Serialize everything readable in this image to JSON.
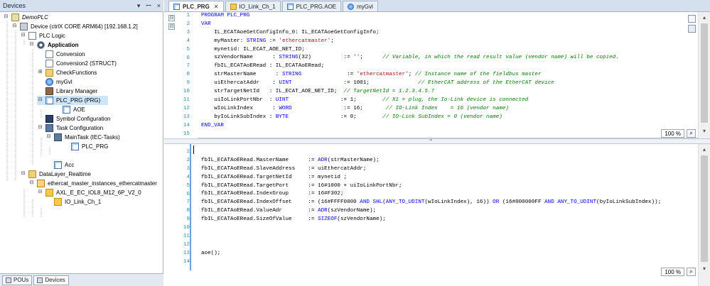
{
  "devices_panel": {
    "title": "Devices",
    "controls": [
      "▾",
      "ꟷ",
      "×"
    ],
    "tree": [
      {
        "label": "DemoPLC",
        "italic": true
      },
      {
        "label": "Device (ctrlX CORE ARM64) [192.168.1.2]"
      },
      {
        "label": "PLC Logic"
      },
      {
        "label": "Application",
        "bold": true
      },
      {
        "label": "Conversion"
      },
      {
        "label": "Conversion2 (STRUCT)"
      },
      {
        "label": "CheckFunctions"
      },
      {
        "label": "myGvl"
      },
      {
        "label": "Library Manager"
      },
      {
        "label": "PLC_PRG (PRG)"
      },
      {
        "label": "AOE"
      },
      {
        "label": "Symbol Configuration"
      },
      {
        "label": "Task Configuration"
      },
      {
        "label": "MainTask (IEC-Tasks)"
      },
      {
        "label": "PLC_PRG"
      },
      {
        "label": "Acc"
      },
      {
        "label": "DataLayer_Realtime"
      },
      {
        "label": "ethercat_master_instances_ethercatmaster"
      },
      {
        "label": "AXL_E_EC_IOL8_M12_6P_V2_0"
      },
      {
        "label": "IO_Link_Ch_1"
      }
    ],
    "bottom_tabs": [
      "POUs",
      "Devices"
    ]
  },
  "editor": {
    "tabs": [
      {
        "label": "PLC_PRG",
        "active": true
      },
      {
        "label": "IO_Link_Ch_1"
      },
      {
        "label": "PLC_PRG.AOE"
      },
      {
        "label": "myGvl"
      }
    ],
    "decl_zoom": "100 %",
    "impl_zoom": "100 %",
    "decl_line_numbers": [
      "1",
      "2",
      "3",
      "4",
      "5",
      "6",
      "7",
      "8",
      "9",
      "10",
      "11",
      "12",
      "13",
      "14",
      "15"
    ],
    "impl_line_numbers": [
      "1",
      "2",
      "3",
      "4",
      "5",
      "6",
      "7",
      "8",
      "9",
      "10",
      "11",
      "12",
      "13",
      "14"
    ],
    "declaration_lines": [
      [
        {
          "t": "PROGRAM PLC_PRG",
          "c": "kw"
        }
      ],
      [
        {
          "t": "VAR",
          "c": "kw"
        }
      ],
      [
        {
          "t": "    IL_ECATAoeGetConfigInfo_0: IL_ECATAoeGetConfigInfo;",
          "c": ""
        }
      ],
      [
        {
          "t": "    myMaster: ",
          "c": ""
        },
        {
          "t": "STRING",
          "c": "kw"
        },
        {
          "t": " := ",
          "c": ""
        },
        {
          "t": "'ethercatmaster'",
          "c": "str"
        },
        {
          "t": ";",
          "c": ""
        }
      ],
      [
        {
          "t": "    mynetid: IL_ECAT_AOE_NET_ID;",
          "c": ""
        }
      ],
      [
        {
          "t": "    szVendorName      : ",
          "c": ""
        },
        {
          "t": "STRING",
          "c": "kw"
        },
        {
          "t": "(32)          := ",
          "c": ""
        },
        {
          "t": "''",
          "c": "str"
        },
        {
          "t": ";      ",
          "c": ""
        },
        {
          "t": "// Variable, in which the read result value (vendor name) will be copied.",
          "c": "cm"
        }
      ],
      [
        {
          "t": "    fbIL_ECATAoERead : IL_ECATAoERead;",
          "c": ""
        }
      ],
      [
        {
          "t": "    strMasterName      : ",
          "c": ""
        },
        {
          "t": "STRING",
          "c": "kw"
        },
        {
          "t": "              := ",
          "c": ""
        },
        {
          "t": "'ethercatmaster'",
          "c": "str"
        },
        {
          "t": "; ",
          "c": ""
        },
        {
          "t": "// Instance name of the fieldbus master",
          "c": "cm"
        }
      ],
      [
        {
          "t": "    uiEthercatAddr    : ",
          "c": ""
        },
        {
          "t": "UINT",
          "c": "kw"
        },
        {
          "t": "                := 1001;               ",
          "c": ""
        },
        {
          "t": "// EtherCAT address of the EtherCAT device",
          "c": "cm"
        }
      ],
      [
        {
          "t": "    strTargetNetId   : IL_ECAT_AOE_NET_ID;  ",
          "c": ""
        },
        {
          "t": "// TargetNetId = 1.2.3.4.5.7",
          "c": "cm"
        }
      ],
      [
        {
          "t": "    uiIoLinkPortNbr  : ",
          "c": ""
        },
        {
          "t": "UINT",
          "c": "kw"
        },
        {
          "t": "                := 1;        ",
          "c": ""
        },
        {
          "t": "// X1 = plug, the Io-Link device is connected",
          "c": "cm"
        }
      ],
      [
        {
          "t": "    wIoLinkIndex      : ",
          "c": ""
        },
        {
          "t": "WORD",
          "c": "kw"
        },
        {
          "t": "                := 16;       ",
          "c": ""
        },
        {
          "t": "// IO-Link Index    = 16 (vendor name)",
          "c": "cm"
        }
      ],
      [
        {
          "t": "    byIoLinkSubIndex : ",
          "c": ""
        },
        {
          "t": "BYTE",
          "c": "kw"
        },
        {
          "t": "                := 0;        ",
          "c": ""
        },
        {
          "t": "// IO-Link SubIndex = 0 (vendor name)",
          "c": "cm"
        }
      ],
      [
        {
          "t": "END_VAR",
          "c": "kw"
        }
      ],
      [
        {
          "t": "",
          "c": ""
        }
      ]
    ],
    "implementation_lines": [
      [
        {
          "t": "",
          "c": ""
        }
      ],
      [
        {
          "t": "fbIL_ECATAoERead.MasterName      := ",
          "c": ""
        },
        {
          "t": "ADR",
          "c": "kw"
        },
        {
          "t": "(strMasterName);",
          "c": ""
        }
      ],
      [
        {
          "t": "fbIL_ECATAoERead.SlaveAddress    := uiEthercatAddr;",
          "c": ""
        }
      ],
      [
        {
          "t": "fbIL_ECATAoERead.TargetNetId     := mynetid ;",
          "c": ""
        }
      ],
      [
        {
          "t": "fbIL_ECATAoERead.TargetPort      := 16#1000 + uiIoLinkPortNbr;",
          "c": ""
        }
      ],
      [
        {
          "t": "fbIL_ECATAoERead.IndexGroup      := 16#F302;",
          "c": ""
        }
      ],
      [
        {
          "t": "fbIL_ECATAoERead.IndexOffset     := (16#FFFF0000 ",
          "c": ""
        },
        {
          "t": "AND",
          "c": "kw"
        },
        {
          "t": " ",
          "c": ""
        },
        {
          "t": "SHL",
          "c": "kw"
        },
        {
          "t": "(",
          "c": ""
        },
        {
          "t": "ANY_TO_UDINT",
          "c": "kw"
        },
        {
          "t": "(wIoLinkIndex), 16)) ",
          "c": ""
        },
        {
          "t": "OR",
          "c": "kw"
        },
        {
          "t": " (16#000000FF ",
          "c": ""
        },
        {
          "t": "AND",
          "c": "kw"
        },
        {
          "t": " ",
          "c": ""
        },
        {
          "t": "ANY_TO_UDINT",
          "c": "kw"
        },
        {
          "t": "(byIoLinkSubIndex));",
          "c": ""
        }
      ],
      [
        {
          "t": "fbIL_ECATAoERead.ValueAdr        := ",
          "c": ""
        },
        {
          "t": "ADR",
          "c": "kw"
        },
        {
          "t": "(szVendorName);",
          "c": ""
        }
      ],
      [
        {
          "t": "fbIL_ECATAoERead.SizeOfValue     := ",
          "c": ""
        },
        {
          "t": "SIZEOF",
          "c": "kw"
        },
        {
          "t": "(szVendorName);",
          "c": ""
        }
      ],
      [
        {
          "t": "",
          "c": ""
        }
      ],
      [
        {
          "t": "",
          "c": ""
        }
      ],
      [
        {
          "t": "",
          "c": ""
        }
      ],
      [
        {
          "t": "aoe();",
          "c": ""
        }
      ],
      [
        {
          "t": "",
          "c": ""
        }
      ]
    ]
  },
  "colors": {
    "keyword": "#0000ff",
    "string": "#a31515",
    "comment": "#008000",
    "header_bg": "#d5e0ee",
    "selection": "#cde6f7"
  },
  "icons": {
    "zoom_icon": "magnifier-icon"
  }
}
